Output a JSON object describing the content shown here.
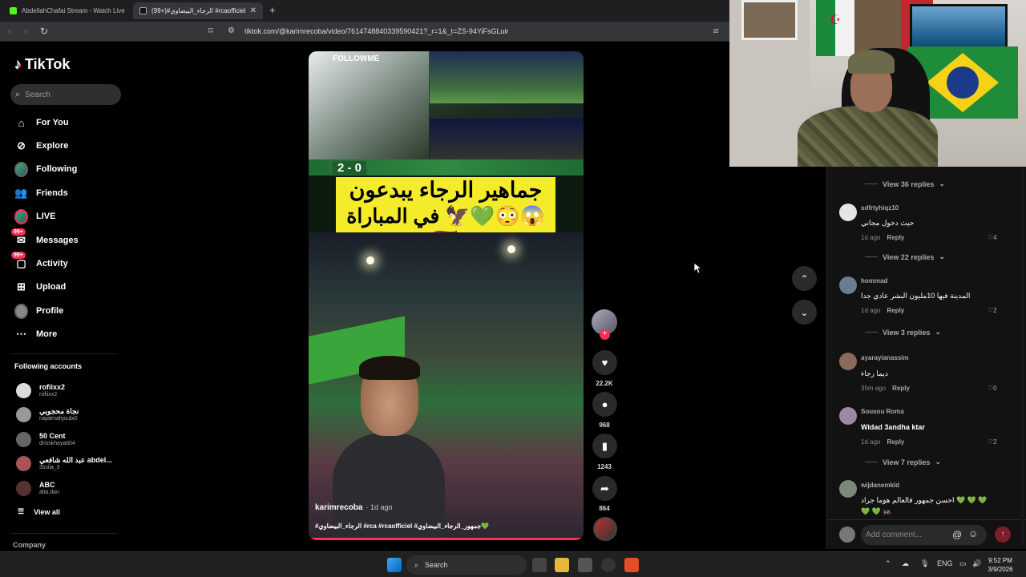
{
  "browser": {
    "tabs": [
      {
        "label": "AbdellahChafai Stream - Watch Live"
      },
      {
        "label": "(99+)#الرجاء_البيضاوي #rcaofficiel"
      }
    ],
    "url": "tiktok.com/@karimrecoba/video/7614748840339590421?_r=1&_t=ZS-94YiFsGLuir"
  },
  "sidebar": {
    "logo": "TikTok",
    "search_placeholder": "Search",
    "nav": [
      {
        "label": "For You",
        "icon": "home-icon"
      },
      {
        "label": "Explore",
        "icon": "compass-icon"
      },
      {
        "label": "Following",
        "icon": "following-avatar"
      },
      {
        "label": "Friends",
        "icon": "friends-icon"
      },
      {
        "label": "LIVE",
        "icon": "live-avatar"
      },
      {
        "label": "Messages",
        "icon": "messages-icon",
        "badge": "99+"
      },
      {
        "label": "Activity",
        "icon": "activity-icon",
        "badge": "99+"
      },
      {
        "label": "Upload",
        "icon": "upload-icon"
      },
      {
        "label": "Profile",
        "icon": "profile-avatar"
      },
      {
        "label": "More",
        "icon": "more-icon"
      }
    ],
    "following_title": "Following accounts",
    "accounts": [
      {
        "name": "rofiixx2",
        "user": "rofiixx2"
      },
      {
        "name": "نجاة محجوبي",
        "user": "najatmahjoubi0"
      },
      {
        "name": "50 Cent",
        "user": "drisskhayati04"
      },
      {
        "name": "عبد الله شافعي abdel...",
        "user": "3ssila_0"
      },
      {
        "name": "ABC",
        "user": "alta.dan"
      }
    ],
    "view_all": "View all",
    "company": "Company"
  },
  "video": {
    "top_caption": "FOLLOWME",
    "score": "2 - 0",
    "banner_line1": "جماهير الرجاء يبدعون",
    "banner_line2": "في المباراة 🦅💚😳😱🇲🇦",
    "author": "karimrecoba",
    "ago": "· 1d ago",
    "tags": "#الرجاء_البيضاوي #rca #rcaofficiel #جمهور_الرجاء_البيضاوي💚",
    "progress": 1.0
  },
  "actions": {
    "likes": "22.2K",
    "comments": "968",
    "saves": "1243",
    "shares": "864"
  },
  "comments": {
    "threads": [
      {
        "view_replies": "View 36 replies"
      },
      {
        "user": "sdfrtyhiqz10",
        "text": "حيث دخول مجاني",
        "time": "1d ago",
        "reply": "Reply",
        "likes": "4",
        "view_replies": "View 22 replies"
      },
      {
        "user": "hommad",
        "text": "المدينة فيها 10مليون البشر عادي جدا",
        "time": "1d ago",
        "reply": "Reply",
        "likes": "2",
        "view_replies": "View 3 replies"
      },
      {
        "user": "ayarayianassim",
        "text": "ديما رجاء",
        "time": "35m ago",
        "reply": "Reply",
        "likes": "0"
      },
      {
        "user": "Sousou Roma",
        "text": "Widad 3andha ktar",
        "time": "1d ago",
        "reply": "Reply",
        "likes": "2",
        "view_replies": "View 7 replies"
      },
      {
        "user": "wijdanemkld",
        "text": "احسن جمهور فالعالم هوما جراد 💚 💚 💚",
        "text2": "💚 💚 🦗"
      }
    ],
    "add_placeholder": "Add comment..."
  },
  "taskbar": {
    "search": "Search",
    "lang": "ENG",
    "time": "9:52 PM",
    "date": "3/9/2026"
  },
  "colors": {
    "accent": "#fe2c55",
    "banner": "#f4ec2a"
  }
}
